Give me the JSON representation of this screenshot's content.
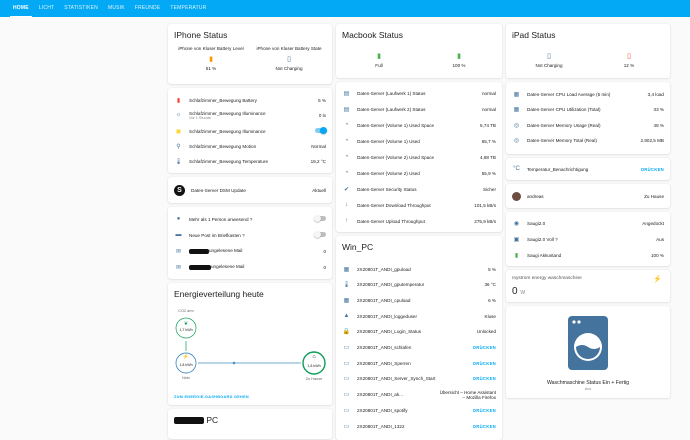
{
  "tabs": [
    "HOME",
    "LICHT",
    "STATISTIKEN",
    "MUSIK",
    "FREUNDE",
    "TEMPERATUR"
  ],
  "colors": {
    "accent": "#03a9f4",
    "icon": "#44739e",
    "battery_orange": "#ff9800",
    "battery_green": "#4caf50",
    "battery_red": "#f44336"
  },
  "iphone": {
    "title": "IPhone Status",
    "battery_level_label": "iPhone von Kluser Battery Level",
    "battery_level_value": "51 %",
    "battery_state_label": "iPhone von Kluser Battery State",
    "battery_state_value": "Not Charging"
  },
  "sensors": [
    {
      "icon": "battery-icon",
      "name": "Schlafzimmer_Bewegung Battery",
      "value": "5 %"
    },
    {
      "icon": "brightness-icon",
      "name": "Schlafzimmer_Bewegung Illuminance",
      "sub": "Vor 1 Stunde",
      "value": "0 lx"
    },
    {
      "icon": "light-sensor-icon",
      "name": "Schlafzimmer_Bewegung Illuminance",
      "value": ""
    },
    {
      "icon": "motion-icon",
      "name": "Schlafzimmer_Bewegung Motion",
      "value": "Normal"
    },
    {
      "icon": "thermometer-icon",
      "name": "Schlafzimmer_Bewegung Temperature",
      "value": "19,2 °C"
    }
  ],
  "dsm": {
    "name": "Daten-Server DSM Update",
    "value": "Aktuell"
  },
  "presence": [
    {
      "name": "Mehr als 1 Person anwesend ?",
      "type": "switch"
    },
    {
      "name": "Neue Post im Briefkasten ?",
      "type": "switch"
    },
    {
      "name": "ungelesene Mail",
      "value": "0"
    },
    {
      "name": "ungelesene Mail",
      "value": "0"
    }
  ],
  "energy": {
    "title": "Energieverteilung heute",
    "co2_label": "CO2 arm",
    "co2_value": "1,7 kWh",
    "grid_label": "Netz",
    "grid_value": "1,8 kWh",
    "home_label": "Zu Hause",
    "home_value": "1,8 kWh",
    "link": "ZUM ENERGIE-DASHBOARD GEHEN"
  },
  "pc_bottom": {
    "title_suffix": "PC"
  },
  "macbook": {
    "title": "Macbook Status",
    "left_value": "Full",
    "right_value": "100 %"
  },
  "server": [
    {
      "name": "Daten-Server (Laufwerk 1) Status",
      "value": "normal"
    },
    {
      "name": "Daten-Server (Laufwerk 2) Status",
      "value": "normal"
    },
    {
      "name": "Daten-Server (Volume 1) Used Space",
      "value": "5,74 TB"
    },
    {
      "name": "Daten-Server (Volume 1) Used",
      "value": "65,7 %"
    },
    {
      "name": "Daten-Server (Volume 2) Used Space",
      "value": "4,88 TB"
    },
    {
      "name": "Daten-Server (Volume 2) Used",
      "value": "55,9 %"
    },
    {
      "name": "Daten-Server Security Status",
      "value": "Sicher"
    },
    {
      "name": "Daten-Server Download Throughput",
      "value": "101,5 kB/s"
    },
    {
      "name": "Daten-Server Upload Throughput",
      "value": "275,9 kB/s"
    }
  ],
  "winpc": {
    "title": "Win_PC",
    "rows": [
      {
        "name": "2X20801T_ANDI_gpuload",
        "value": "5 %"
      },
      {
        "name": "2X20801T_ANDI_gputemperatur",
        "value": "36 °C"
      },
      {
        "name": "2X20801T_ANDI_cpuload",
        "value": "6 %"
      },
      {
        "name": "2X20801T_ANDI_loggeduser",
        "value": "Kluse"
      },
      {
        "name": "2X20801T_ANDI_Login_Status",
        "value": "Unlocked"
      },
      {
        "name": "2X20801T_ANDI_schlafen",
        "value": "DRÜCKEN",
        "action": true
      },
      {
        "name": "2X20801T_ANDI_Sperren",
        "value": "DRÜCKEN",
        "action": true
      },
      {
        "name": "2X20801T_ANDI_Server_Synch_Start",
        "value": "DRÜCKEN",
        "action": true
      },
      {
        "name": "2X20801T_ANDI_ak...",
        "value": "Übersicht – Home Assistant – Mozilla Firefox"
      },
      {
        "name": "2X20801T_ANDI_spotify",
        "value": "DRÜCKEN",
        "action": true
      },
      {
        "name": "2X20801T_ANDI_1322",
        "value": "DRÜCKEN",
        "action": true
      }
    ]
  },
  "ipad": {
    "title": "iPad Status",
    "left_value": "Not Charging",
    "right_value": "12 %"
  },
  "ipad_server": [
    {
      "name": "Daten-Server CPU Load Average (5 min)",
      "value": "3,4 load"
    },
    {
      "name": "Daten-Server CPU Utilization (Total)",
      "value": "33 %"
    },
    {
      "name": "Daten-Server Memory Usage (Real)",
      "value": "48 %"
    },
    {
      "name": "Daten-Server Memory Total (Real)",
      "value": "2.802,5 MB"
    }
  ],
  "temp_notify": {
    "name": "Temperatur_Benachrichtigung",
    "action": "DRÜCKEN"
  },
  "person": {
    "name": "andreas",
    "value": "Zu Hause"
  },
  "vacuum": [
    {
      "name": "Saugi2.0",
      "value": "Angedockt"
    },
    {
      "name": "Saugi2.0 Voll ?",
      "value": "Aus"
    },
    {
      "name": "Saugi Akkustand",
      "value": "100 %"
    }
  ],
  "mystrom": {
    "name": "mystrom energy waschmaschine",
    "value": "0",
    "unit": "W"
  },
  "washer": {
    "label": "Waschmaschine Status Ein + Fertig",
    "state": "Aus"
  }
}
